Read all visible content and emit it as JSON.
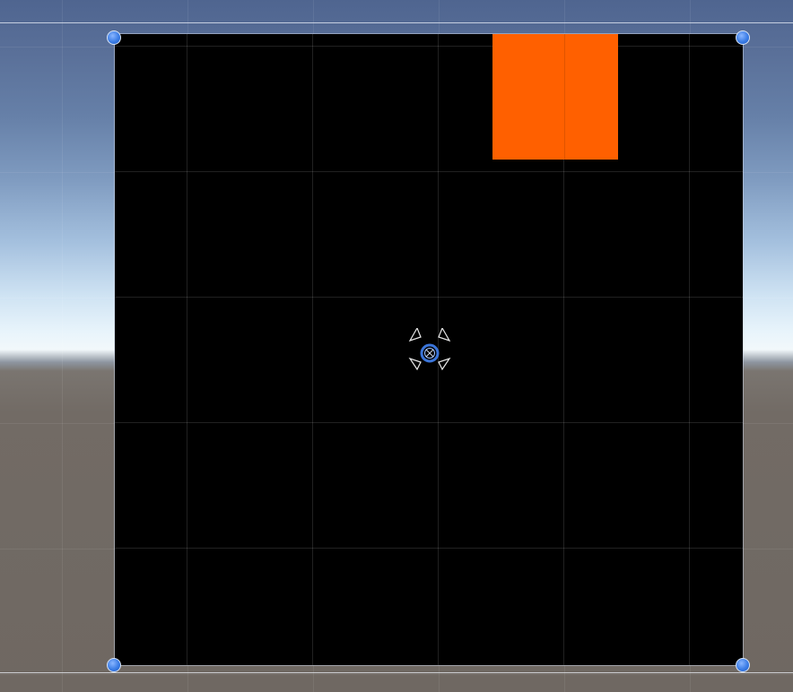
{
  "scene_view": {
    "selected_object": "canvas-rect",
    "canvas": {
      "background_color": "#000000"
    },
    "panel": {
      "color": "#ff6000"
    },
    "handle_color": "#3a7ce6",
    "pivot": {
      "icon": "anchor-icon"
    }
  }
}
